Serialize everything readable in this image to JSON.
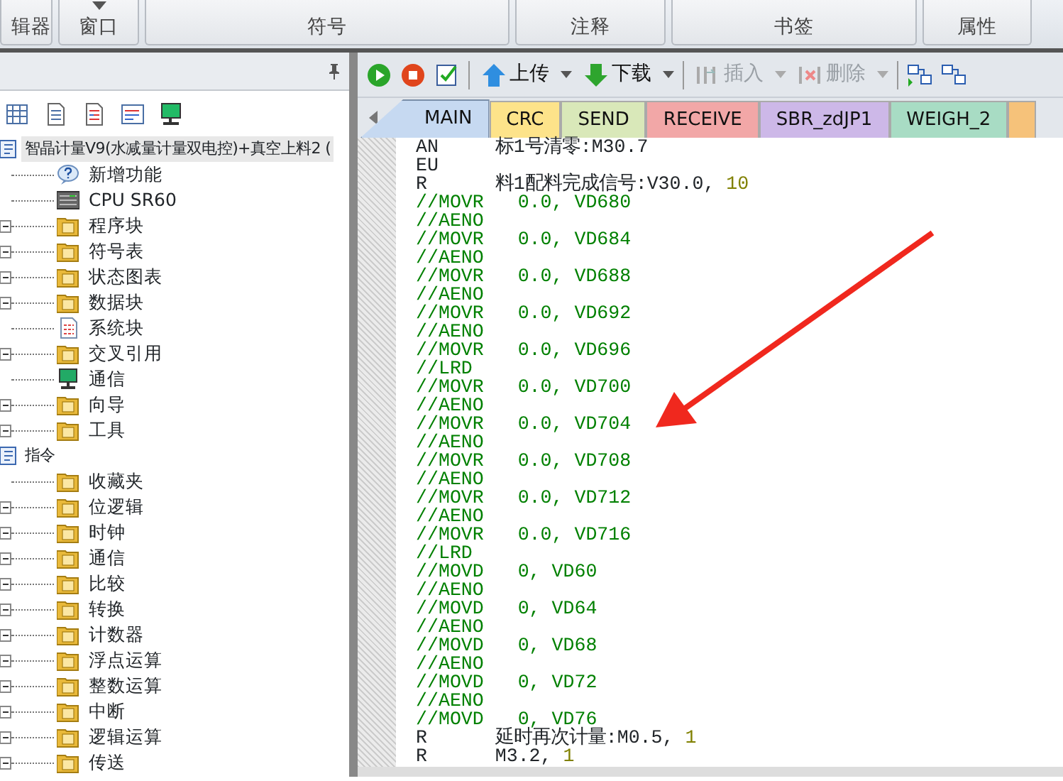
{
  "ribbon": {
    "groups": [
      "辑器",
      "窗口",
      "符号",
      "注释",
      "书签",
      "属性"
    ]
  },
  "project_panel": {
    "tree": [
      {
        "label": "智晶计量V9(水减量计量双电控)+真空上料2 (",
        "selected": true,
        "children": [
          {
            "label": "新增功能",
            "kind": "help",
            "expander": false
          },
          {
            "label": "CPU SR60",
            "kind": "cpu",
            "expander": false
          },
          {
            "label": "程序块",
            "kind": "folder",
            "expander": true
          },
          {
            "label": "符号表",
            "kind": "folder",
            "expander": true
          },
          {
            "label": "状态图表",
            "kind": "folder",
            "expander": true
          },
          {
            "label": "数据块",
            "kind": "folder",
            "expander": true
          },
          {
            "label": "系统块",
            "kind": "doc",
            "expander": false
          },
          {
            "label": "交叉引用",
            "kind": "folder",
            "expander": true
          },
          {
            "label": "通信",
            "kind": "monitor",
            "expander": false
          },
          {
            "label": "向导",
            "kind": "folder",
            "expander": true
          },
          {
            "label": "工具",
            "kind": "folder",
            "expander": true
          }
        ]
      },
      {
        "label": "指令",
        "selected": false,
        "children": [
          {
            "label": "收藏夹",
            "kind": "folder",
            "expander": false
          },
          {
            "label": "位逻辑",
            "kind": "folder",
            "expander": true
          },
          {
            "label": "时钟",
            "kind": "folder",
            "expander": true
          },
          {
            "label": "通信",
            "kind": "folder",
            "expander": true
          },
          {
            "label": "比较",
            "kind": "folder",
            "expander": true
          },
          {
            "label": "转换",
            "kind": "folder",
            "expander": true
          },
          {
            "label": "计数器",
            "kind": "folder",
            "expander": true
          },
          {
            "label": "浮点运算",
            "kind": "folder",
            "expander": true
          },
          {
            "label": "整数运算",
            "kind": "folder",
            "expander": true
          },
          {
            "label": "中断",
            "kind": "folder",
            "expander": true
          },
          {
            "label": "逻辑运算",
            "kind": "folder",
            "expander": true
          },
          {
            "label": "传送",
            "kind": "folder",
            "expander": true
          }
        ]
      }
    ]
  },
  "toolbar": [
    {
      "kind": "run"
    },
    {
      "kind": "stop"
    },
    {
      "kind": "compile"
    },
    {
      "kind": "sep"
    },
    {
      "kind": "upload",
      "label": "上传",
      "disabled": false
    },
    {
      "kind": "download",
      "label": "下载",
      "disabled": false
    },
    {
      "kind": "sep"
    },
    {
      "kind": "insert",
      "label": "插入",
      "disabled": true
    },
    {
      "kind": "delete",
      "label": "删除",
      "disabled": true
    },
    {
      "kind": "sep"
    },
    {
      "kind": "net1"
    },
    {
      "kind": "net2"
    }
  ],
  "tabs": [
    {
      "label": "MAIN",
      "color": "#c6d9f1",
      "selected": true
    },
    {
      "label": "CRC",
      "color": "#fde38a",
      "selected": false
    },
    {
      "label": "SEND",
      "color": "#d9e8b9",
      "selected": false
    },
    {
      "label": "RECEIVE",
      "color": "#f2a7a7",
      "selected": false
    },
    {
      "label": "SBR_zdJP1",
      "color": "#cdb8e8",
      "selected": false
    },
    {
      "label": "WEIGH_2",
      "color": "#a8dcc4",
      "selected": false
    },
    {
      "color": "#f6c27a",
      "selected": false
    }
  ],
  "code": [
    {
      "kind": "code",
      "text": "AN     标1号清零:M30.7"
    },
    {
      "kind": "code",
      "text": "EU"
    },
    {
      "kind": "code",
      "text": "R      料1配料完成信号:V30.0, ",
      "value": "10"
    },
    {
      "kind": "comment",
      "text": "//MOVR   0.0, VD680"
    },
    {
      "kind": "comment",
      "text": "//AENO"
    },
    {
      "kind": "comment",
      "text": "//MOVR   0.0, VD684"
    },
    {
      "kind": "comment",
      "text": "//AENO"
    },
    {
      "kind": "comment",
      "text": "//MOVR   0.0, VD688"
    },
    {
      "kind": "comment",
      "text": "//AENO"
    },
    {
      "kind": "comment",
      "text": "//MOVR   0.0, VD692"
    },
    {
      "kind": "comment",
      "text": "//AENO"
    },
    {
      "kind": "comment",
      "text": "//MOVR   0.0, VD696"
    },
    {
      "kind": "comment",
      "text": "//LRD"
    },
    {
      "kind": "comment",
      "text": "//MOVR   0.0, VD700"
    },
    {
      "kind": "comment",
      "text": "//AENO"
    },
    {
      "kind": "comment",
      "text": "//MOVR   0.0, VD704"
    },
    {
      "kind": "comment",
      "text": "//AENO"
    },
    {
      "kind": "comment",
      "text": "//MOVR   0.0, VD708"
    },
    {
      "kind": "comment",
      "text": "//AENO"
    },
    {
      "kind": "comment",
      "text": "//MOVR   0.0, VD712"
    },
    {
      "kind": "comment",
      "text": "//AENO"
    },
    {
      "kind": "comment",
      "text": "//MOVR   0.0, VD716"
    },
    {
      "kind": "comment",
      "text": "//LRD"
    },
    {
      "kind": "comment",
      "text": "//MOVD   0, VD60"
    },
    {
      "kind": "comment",
      "text": "//AENO"
    },
    {
      "kind": "comment",
      "text": "//MOVD   0, VD64"
    },
    {
      "kind": "comment",
      "text": "//AENO"
    },
    {
      "kind": "comment",
      "text": "//MOVD   0, VD68"
    },
    {
      "kind": "comment",
      "text": "//AENO"
    },
    {
      "kind": "comment",
      "text": "//MOVD   0, VD72"
    },
    {
      "kind": "comment",
      "text": "//AENO"
    },
    {
      "kind": "comment",
      "text": "//MOVD   0, VD76"
    },
    {
      "kind": "code",
      "text": "R      延时再次计量:M0.5, ",
      "value": "1"
    },
    {
      "kind": "code",
      "text": "R      M3.2, ",
      "value": "1"
    }
  ]
}
